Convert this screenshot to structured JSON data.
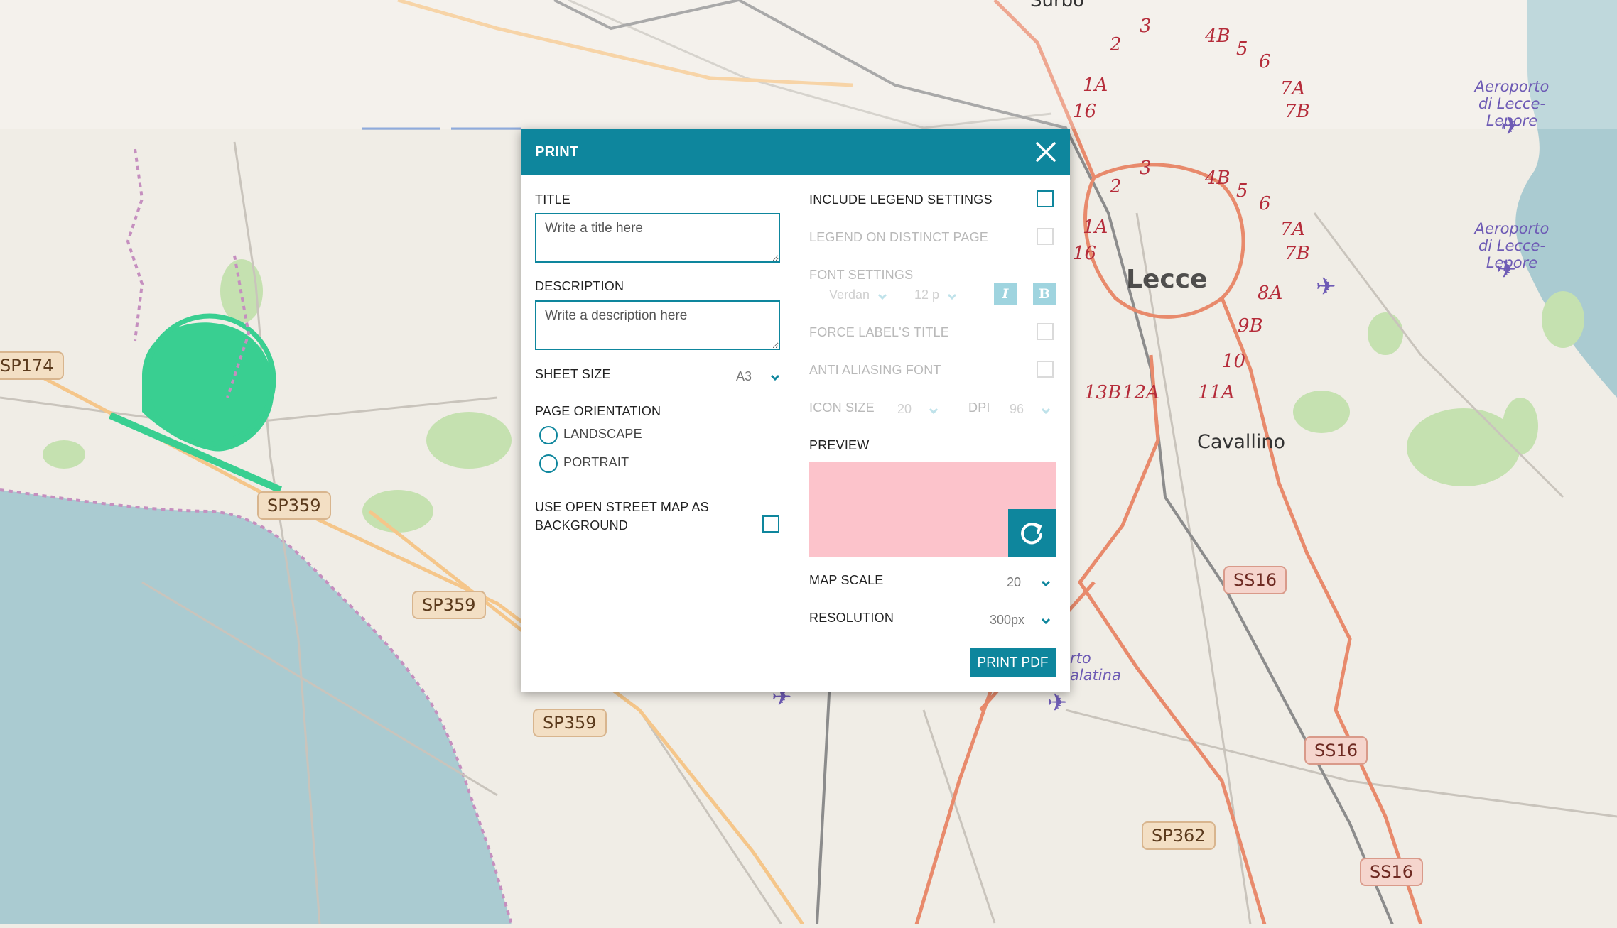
{
  "map": {
    "road_labels": [
      "SP174",
      "SP359",
      "SP359",
      "SP359",
      "SS16",
      "SS16",
      "SS16",
      "SP362"
    ],
    "ring_numbers": [
      "3",
      "2",
      "4B",
      "5",
      "6",
      "1A",
      "7A",
      "16",
      "7B",
      "8A",
      "9B",
      "10",
      "13B",
      "12A",
      "11A"
    ],
    "ring_numbers_top": [
      "3",
      "2",
      "4B",
      "5",
      "6",
      "1A",
      "7A",
      "16",
      "7B"
    ],
    "place_lecce": "Lecce",
    "place_cavallino": "Cavallino",
    "place_surbo": "Surbo",
    "airport_lecce_1": "Aeroporto",
    "airport_lecce_2": "di Lecce-Lepore",
    "airport_galatina_1": "rto",
    "airport_galatina_2": "alatina",
    "colors": {
      "water": "#aacbd1",
      "land": "#f0ede6",
      "ring_road": "#e88a6c",
      "green_area": "#39cf91"
    }
  },
  "dialog": {
    "title": "PRINT",
    "close_icon": "close-icon",
    "left": {
      "title_label": "TITLE",
      "title_placeholder": "Write a title here",
      "description_label": "DESCRIPTION",
      "description_placeholder": "Write a description here",
      "sheet_size_label": "SHEET SIZE",
      "sheet_size_value": "A3",
      "orientation_label": "PAGE ORIENTATION",
      "landscape_label": "LANDSCAPE",
      "portrait_label": "PORTRAIT",
      "osm_label_1": "USE OPEN STREET MAP AS",
      "osm_label_2": "BACKGROUND"
    },
    "right": {
      "include_legend_label": "INCLUDE LEGEND SETTINGS",
      "legend_distinct_label": "LEGEND ON DISTINCT PAGE",
      "font_settings_label": "FONT SETTINGS",
      "font_family_value": "Verdan",
      "font_size_value": "12 p",
      "italic_label": "I",
      "bold_label": "B",
      "force_label_title": "FORCE LABEL'S TITLE",
      "anti_aliasing_label": "ANTI ALIASING FONT",
      "icon_size_label": "ICON SIZE",
      "icon_size_value": "20",
      "dpi_label": "DPI",
      "dpi_value": "96",
      "preview_label": "PREVIEW",
      "preview_color": "#fcc3cb",
      "map_scale_label": "MAP SCALE",
      "map_scale_value": "20",
      "resolution_label": "RESOLUTION",
      "resolution_value": "300px",
      "print_button": "PRINT PDF"
    },
    "accent_color": "#0e869d"
  }
}
